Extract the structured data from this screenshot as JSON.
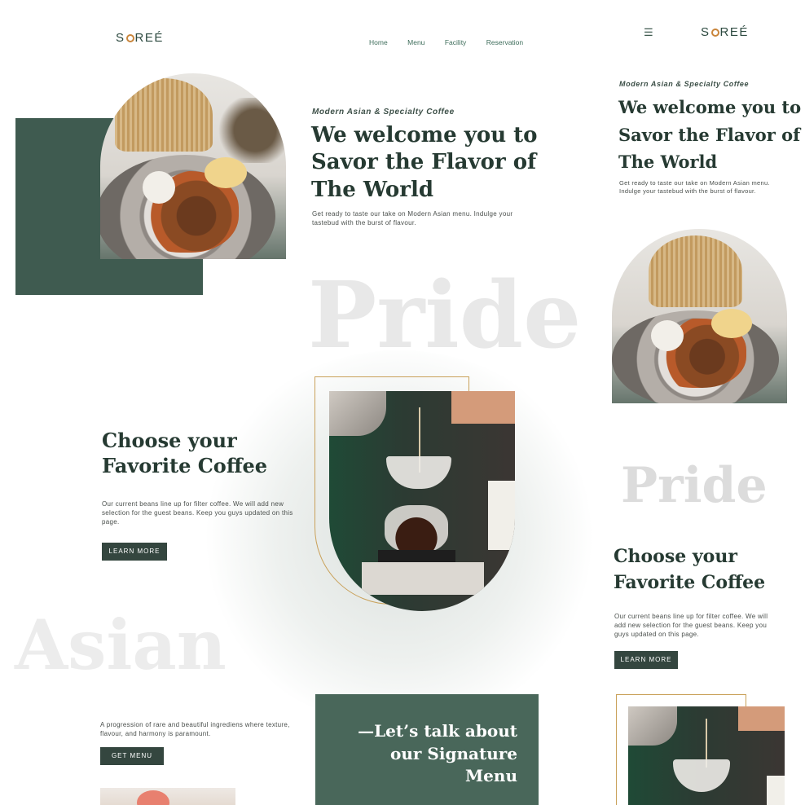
{
  "brand": {
    "logo_text_left": "S",
    "logo_text_right": "REÉ"
  },
  "nav": {
    "home": "Home",
    "menu": "Menu",
    "facility": "Facility",
    "reservation": "Reservation"
  },
  "hero": {
    "eyebrow": "Modern Asian & Specialty Coffee",
    "title_line1": "We welcome you to",
    "title_line2": "Savor the Flavor of",
    "title_line3": "The World",
    "body": "Get ready to taste our take on Modern Asian menu. Indulge your tastebud with the burst of flavour."
  },
  "ghost_pride": "Pride",
  "ghost_asian": "Asian",
  "coffee": {
    "title_line1": "Choose your",
    "title_line2": "Favorite Coffee",
    "body": "Our current beans line up for filter coffee. We will add new selection for the guest beans. Keep you guys updated on this page.",
    "button": "LEARN MORE"
  },
  "menu_section": {
    "body": "A progression of rare and beautiful ingrediens where texture, flavour, and harmony is paramount.",
    "button": "GET MENU",
    "banner_line1": "—Let’s talk about",
    "banner_line2": "our Signature",
    "banner_line3": "Menu"
  },
  "mobile": {
    "menu_icon": "☰",
    "eyebrow": "Modern Asian & Specialty Coffee",
    "title_line1": "We welcome you to",
    "title_line2": "Savor the Flavor of",
    "title_line3": "The World",
    "body": "Get ready to taste our take on Modern Asian menu. Indulge your tastebud with the burst of flavour.",
    "ghost": "Pride",
    "coffee_line1": "Choose your",
    "coffee_line2": "Favorite Coffee",
    "coffee_body": "Our current beans line up for filter coffee. We will add new selection for the guest beans. Keep you guys updated on this page.",
    "coffee_button": "LEARN MORE"
  },
  "colors": {
    "dark_green": "#3f5b50",
    "banner_green": "#49675a",
    "button": "#34463f",
    "gold": "#c9a15a"
  }
}
